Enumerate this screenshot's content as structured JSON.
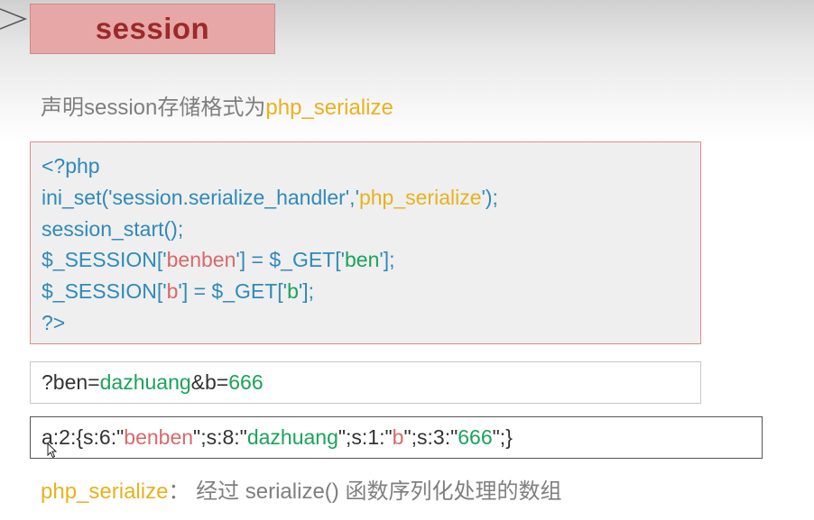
{
  "title": "session",
  "heading": {
    "prefix": "声明session存储格式为",
    "highlight": "php_serialize"
  },
  "code_lines": {
    "line1": "<?php",
    "line2": {
      "a": "ini_set('session.serialize_handler','",
      "b": "php_serialize",
      "c": "');"
    },
    "line3": "session_start();",
    "line4": {
      "a": "$_SESSION['",
      "b": "benben",
      "c": "'] = $_GET['",
      "d": "ben",
      "e": "'];"
    },
    "line5": {
      "a": "$_SESSION['",
      "b": "b",
      "c": "'] = $_GET['",
      "d": "b",
      "e": "'];"
    },
    "line6": "?>"
  },
  "query": {
    "p1": "?ben=",
    "p2": "dazhuang",
    "p3": "&b=",
    "p4": "666"
  },
  "result": {
    "p1": "a:2:{s:6:\"",
    "p2": "benben",
    "p3": "\";s:8:\"",
    "p4": "dazhuang",
    "p5": "\";s:1:\"",
    "p6": "b",
    "p7": "\";s:3:\"",
    "p8": "666",
    "p9": "\";}"
  },
  "footer": {
    "highlight": "php_serialize",
    "separator": "：",
    "text": "经过 serialize() 函数序列化处理的数组"
  },
  "colors": {
    "title_bg": "#e8a7a7",
    "title_text": "#9b2a2a",
    "code_blue": "#2f8ab9",
    "string_yellow": "#e8b21e",
    "string_red": "#d76a6a",
    "string_green": "#1aa35a",
    "gray_text": "#7f7f7f"
  },
  "icons": {
    "arrow": "slide-arrow-icon",
    "cursor": "mouse-pointer-icon"
  }
}
